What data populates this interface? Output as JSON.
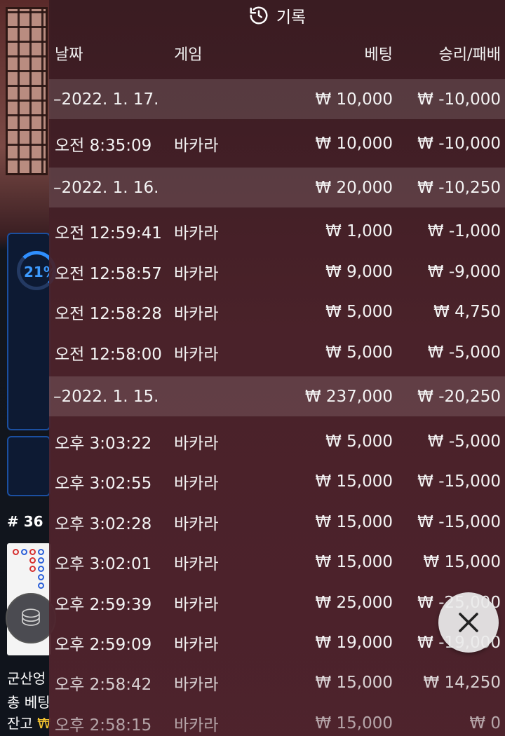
{
  "background": {
    "progress_percent": "21%",
    "round": "# 36",
    "player_name": "군산엉",
    "total_bet_label": "총 베팅",
    "balance_label": "잔고",
    "balance_currency": "₩"
  },
  "panel": {
    "title": "기록",
    "title_icon": "history-icon",
    "headers": {
      "date": "날짜",
      "game": "게임",
      "bet": "베팅",
      "result": "승리/패배"
    }
  },
  "rows": [
    {
      "type": "group",
      "date": "–2022. 1. 17.",
      "game": "",
      "bet": "₩ 10,000",
      "result": "₩ -10,000"
    },
    {
      "type": "item",
      "date": "오전 8:35:09",
      "game": "바카라",
      "bet": "₩ 10,000",
      "result": "₩ -10,000"
    },
    {
      "type": "group",
      "date": "–2022. 1. 16.",
      "game": "",
      "bet": "₩ 20,000",
      "result": "₩ -10,250"
    },
    {
      "type": "item",
      "date": "오전 12:59:41",
      "game": "바카라",
      "bet": "₩ 1,000",
      "result": "₩ -1,000"
    },
    {
      "type": "item",
      "date": "오전 12:58:57",
      "game": "바카라",
      "bet": "₩ 9,000",
      "result": "₩ -9,000"
    },
    {
      "type": "item",
      "date": "오전 12:58:28",
      "game": "바카라",
      "bet": "₩ 5,000",
      "result": "₩ 4,750"
    },
    {
      "type": "item",
      "date": "오전 12:58:00",
      "game": "바카라",
      "bet": "₩ 5,000",
      "result": "₩ -5,000"
    },
    {
      "type": "group",
      "date": "–2022. 1. 15.",
      "game": "",
      "bet": "₩ 237,000",
      "result": "₩ -20,250"
    },
    {
      "type": "item",
      "date": "오후 3:03:22",
      "game": "바카라",
      "bet": "₩ 5,000",
      "result": "₩ -5,000"
    },
    {
      "type": "item",
      "date": "오후 3:02:55",
      "game": "바카라",
      "bet": "₩ 15,000",
      "result": "₩ -15,000"
    },
    {
      "type": "item",
      "date": "오후 3:02:28",
      "game": "바카라",
      "bet": "₩ 15,000",
      "result": "₩ -15,000"
    },
    {
      "type": "item",
      "date": "오후 3:02:01",
      "game": "바카라",
      "bet": "₩ 15,000",
      "result": "₩ 15,000"
    },
    {
      "type": "item",
      "date": "오후 2:59:39",
      "game": "바카라",
      "bet": "₩ 25,000",
      "result": "₩ -25,000"
    },
    {
      "type": "item",
      "date": "오후 2:59:09",
      "game": "바카라",
      "bet": "₩ 19,000",
      "result": "₩ -19,000"
    },
    {
      "type": "item",
      "date": "오후 2:58:42",
      "game": "바카라",
      "bet": "₩ 15,000",
      "result": "₩ 14,250"
    },
    {
      "type": "item",
      "date": "오후 2:58:15",
      "game": "바카라",
      "bet": "₩ 15,000",
      "result": "₩ 0"
    }
  ],
  "close_icon": "close-icon"
}
